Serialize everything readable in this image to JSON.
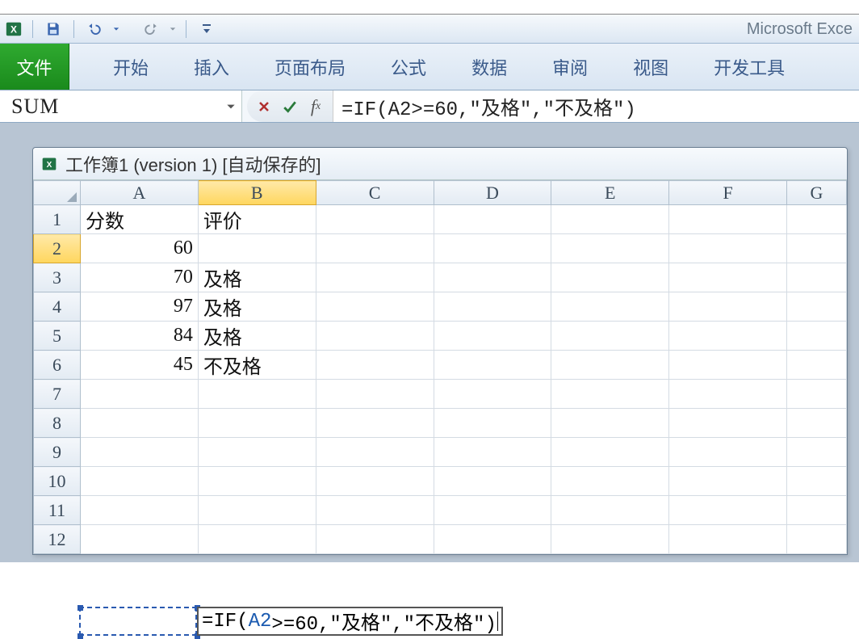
{
  "app": {
    "title": "Microsoft Exce"
  },
  "ribbon": {
    "file": "文件",
    "tabs": [
      "开始",
      "插入",
      "页面布局",
      "公式",
      "数据",
      "审阅",
      "视图",
      "开发工具"
    ]
  },
  "formula_bar": {
    "name_box": "SUM",
    "formula": "=IF(A2>=60,\"及格\",\"不及格\")"
  },
  "workbook": {
    "title": "工作簿1 (version 1) [自动保存的]"
  },
  "columns": [
    "A",
    "B",
    "C",
    "D",
    "E",
    "F",
    "G"
  ],
  "selected_column": "B",
  "selected_row": 2,
  "row_count": 12,
  "cells": {
    "A1": {
      "text": "分数",
      "align": "txt"
    },
    "B1": {
      "text": "评价",
      "align": "txt"
    },
    "A2": {
      "text": "60",
      "align": "num"
    },
    "A3": {
      "text": "70",
      "align": "num"
    },
    "B3": {
      "text": "及格",
      "align": "txt"
    },
    "A4": {
      "text": "97",
      "align": "num"
    },
    "B4": {
      "text": "及格",
      "align": "txt"
    },
    "A5": {
      "text": "84",
      "align": "num"
    },
    "B5": {
      "text": "及格",
      "align": "txt"
    },
    "A6": {
      "text": "45",
      "align": "num"
    },
    "B6": {
      "text": "不及格",
      "align": "txt"
    }
  },
  "editing": {
    "cell": "B2",
    "parts": [
      {
        "t": "=IF("
      },
      {
        "t": "A2",
        "cls": "formula-ref"
      },
      {
        "t": ">=60,\"及格\",\"不及格\")"
      }
    ],
    "ref_range": "A2"
  },
  "icons": {
    "save": "save-icon",
    "undo": "undo-icon",
    "redo": "redo-icon",
    "customize": "customize-qat-icon",
    "cancel": "cancel-icon",
    "enter": "enter-icon",
    "fx": "fx-icon"
  }
}
